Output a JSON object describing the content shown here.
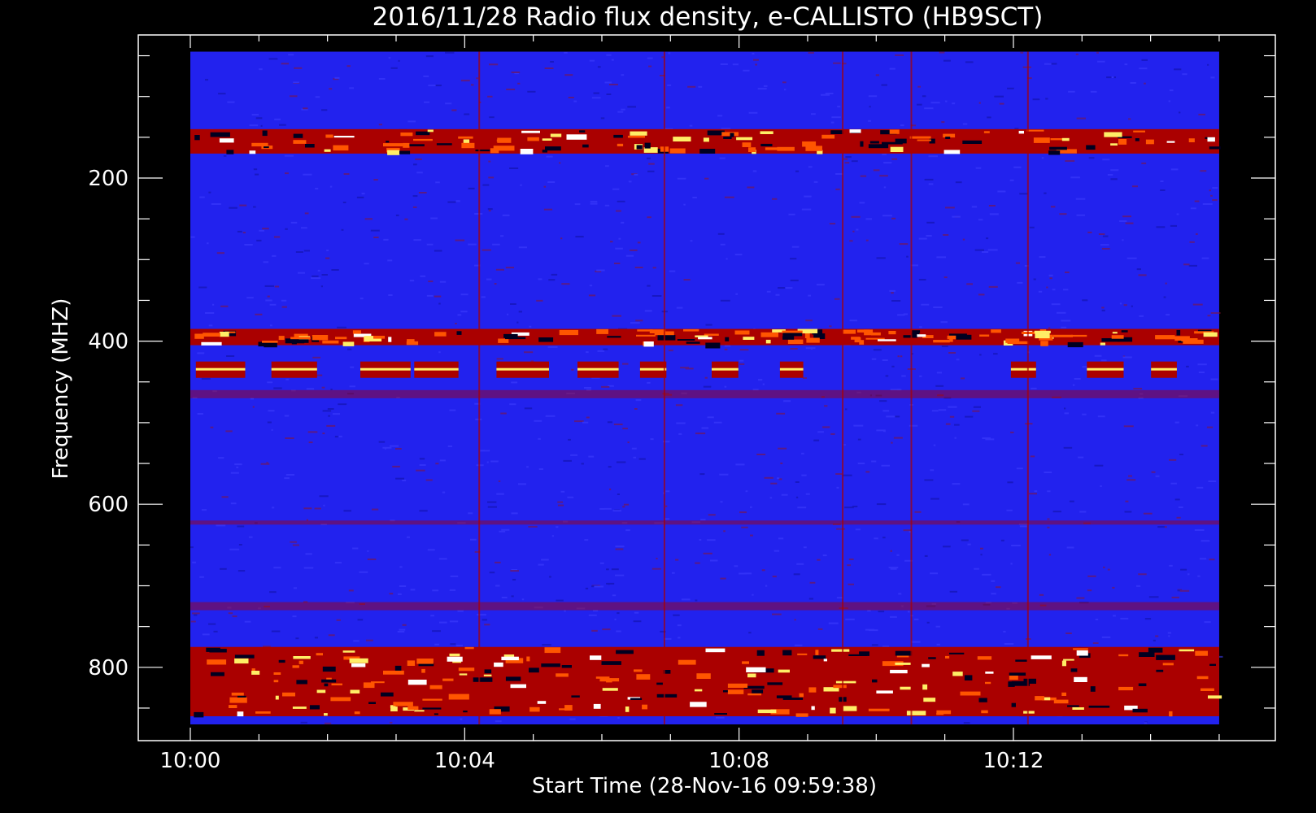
{
  "chart_data": {
    "type": "heatmap",
    "title": "2016/11/28  Radio flux density, e-CALLISTO (HB9SCT)",
    "xlabel": "Start Time (28-Nov-16 09:59:38)",
    "ylabel": "Frequency (MHZ)",
    "x_ticks": [
      "10:00",
      "10:04",
      "10:08",
      "10:12"
    ],
    "x_tick_minutes": [
      0,
      4,
      8,
      12
    ],
    "y_ticks": [
      200,
      400,
      600,
      800
    ],
    "ylim": [
      890,
      25
    ],
    "x_minor_step_min": 1,
    "y_minor_step_mhz": 50,
    "data_xrange_min": [
      0,
      15
    ],
    "data_yrange_mhz": [
      45,
      870
    ],
    "colors": {
      "background": "#000000",
      "frame": "#ffffff",
      "low": "#2222ee",
      "mid": "#aa0000",
      "high": "#ff5500",
      "peak": "#ffee66",
      "void": "#000020"
    },
    "bands": [
      {
        "freq": [
          140,
          170
        ],
        "level": "rfi-strong"
      },
      {
        "freq": [
          385,
          405
        ],
        "level": "rfi-strong"
      },
      {
        "freq": [
          425,
          445
        ],
        "level": "rfi-patchy"
      },
      {
        "freq": [
          460,
          470
        ],
        "level": "rfi-weak"
      },
      {
        "freq": [
          620,
          625
        ],
        "level": "weak"
      },
      {
        "freq": [
          720,
          730
        ],
        "level": "weak"
      },
      {
        "freq": [
          775,
          860
        ],
        "level": "rfi-dense"
      }
    ],
    "time_streaks_min": [
      4.2,
      6.9,
      9.5,
      10.5,
      12.2
    ]
  }
}
